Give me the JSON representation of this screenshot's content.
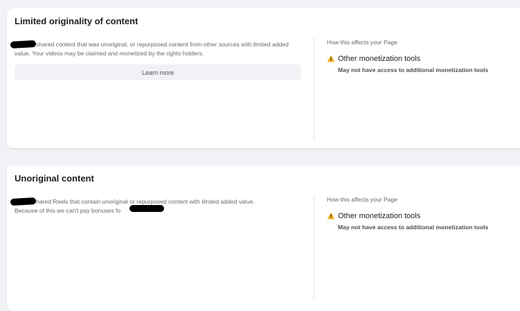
{
  "sections": [
    {
      "title": "Limited originality of content",
      "description": "shared content that was unoriginal, or repurposed content from other sources with limited added value. Your videos may be claimed and monetized by the rights holders.",
      "learn_more_label": "Learn more",
      "impact_heading": "How this affects your Page",
      "impact_title": "Other monetization tools",
      "impact_description": "May not have access to additional monetization tools"
    },
    {
      "title": "Unoriginal content",
      "description_line1": "hared Reels that contain unoriginal or repurposed content with limited added value.",
      "description_line2": "Because of this we can't pay bonuses fo",
      "impact_heading": "How this affects your Page",
      "impact_title": "Other monetization tools",
      "impact_description": "May not have access to additional monetization tools"
    }
  ],
  "colors": {
    "warning": "#f7b928",
    "page_bg": "#f0f2f5",
    "card_bg": "#ffffff"
  },
  "icons": {
    "warning": "warning-triangle-icon"
  }
}
